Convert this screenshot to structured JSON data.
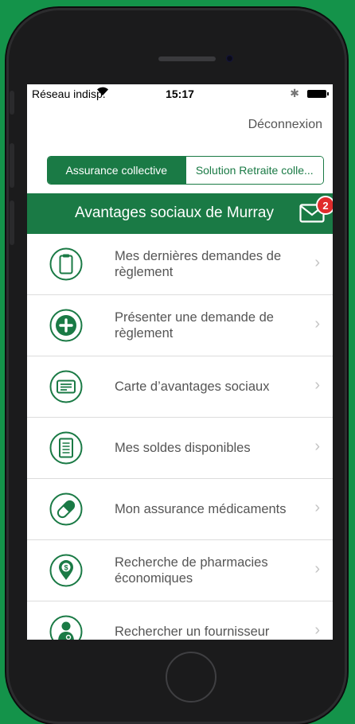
{
  "status_bar": {
    "carrier": "Réseau indisp.",
    "time": "15:17",
    "bluetooth": "✱"
  },
  "header": {
    "logout_label": "Déconnexion"
  },
  "segments": [
    {
      "label": "Assurance collective",
      "selected": true
    },
    {
      "label": "Solution Retraite colle...",
      "selected": false
    }
  ],
  "banner": {
    "title": "Avantages sociaux de Murray",
    "badge_count": "2"
  },
  "menu": [
    {
      "label": "Mes dernières demandes de règlement",
      "icon": "clipboard-icon"
    },
    {
      "label": "Présenter une demande de règlement",
      "icon": "plus-circle-icon"
    },
    {
      "label": "Carte d’avantages sociaux",
      "icon": "benefits-card-icon"
    },
    {
      "label": "Mes soldes disponibles",
      "icon": "document-icon"
    },
    {
      "label": "Mon assurance médicaments",
      "icon": "pill-icon"
    },
    {
      "label": "Recherche de pharmacies économiques",
      "icon": "pharmacy-location-icon"
    },
    {
      "label": "Rechercher un fournisseur",
      "icon": "doctor-icon"
    }
  ],
  "colors": {
    "brand_green": "#1a7a45",
    "background_green": "#14934a",
    "badge_red": "#e02b2b"
  }
}
